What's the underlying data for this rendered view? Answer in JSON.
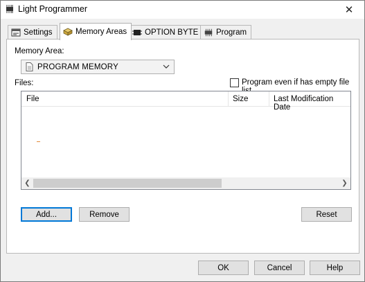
{
  "window": {
    "title": "Light Programmer",
    "close_label": "✕"
  },
  "tabs": [
    {
      "label": "Settings",
      "icon": "settings-icon",
      "active": false
    },
    {
      "label": "Memory Areas",
      "icon": "memory-areas-icon",
      "active": true
    },
    {
      "label": "OPTION BYTE",
      "icon": "option-byte-icon",
      "active": false
    },
    {
      "label": "Program",
      "icon": "program-chip-icon",
      "active": false
    }
  ],
  "memory_area": {
    "label": "Memory Area:",
    "selected": "PROGRAM MEMORY"
  },
  "files": {
    "label": "Files:",
    "empty_list_checkbox_label": "Program even if has empty file list",
    "empty_list_checked": false,
    "columns": [
      "File",
      "Size",
      "Last Modification Date"
    ],
    "rows": []
  },
  "panel_buttons": {
    "add": "Add...",
    "remove": "Remove",
    "reset": "Reset"
  },
  "dialog_buttons": {
    "ok": "OK",
    "cancel": "Cancel",
    "help": "Help"
  },
  "colors": {
    "accent": "#0078d7",
    "window_bg": "#f0f0f0",
    "panel_bg": "#ffffff"
  }
}
